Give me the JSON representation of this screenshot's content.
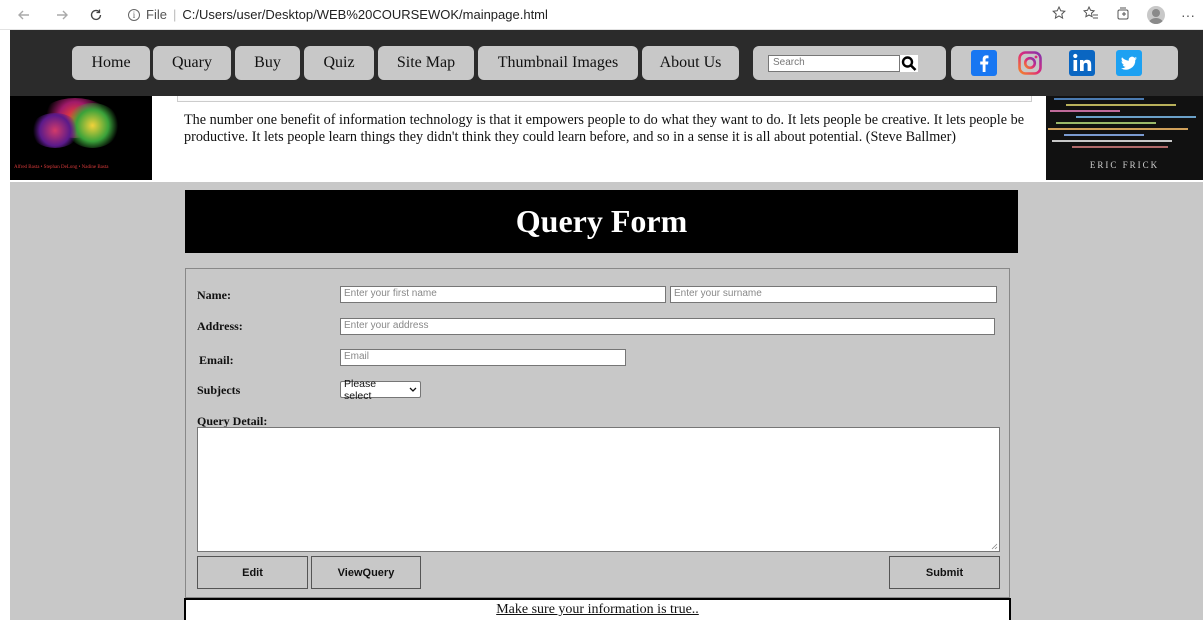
{
  "browser": {
    "back_icon": "back-arrow-icon",
    "forward_icon": "forward-arrow-icon",
    "refresh_icon": "refresh-icon",
    "info_label": "File",
    "url": "C:/Users/user/Desktop/WEB%20COURSEWOK/mainpage.html",
    "right_icons": [
      "read-aloud-icon",
      "favorites-icon",
      "collections-icon",
      "profile-avatar",
      "more-icon"
    ],
    "more_label": "···"
  },
  "nav": {
    "items": [
      "Home",
      "Quary",
      "Buy",
      "Quiz",
      "Site Map",
      "Thumbnail Images",
      "About Us"
    ],
    "search_placeholder": "Search",
    "social": [
      {
        "name": "facebook",
        "color": "#1877F2"
      },
      {
        "name": "instagram",
        "color": "#C13584"
      },
      {
        "name": "linkedin",
        "color": "#0A66C2"
      },
      {
        "name": "twitter",
        "color": "#1DA1F2"
      }
    ]
  },
  "header": {
    "quote": "The number one benefit of information technology is that it empowers people to do what they want to do. It lets people be creative. It lets people be productive. It lets people learn things they didn't think they could learn before, and so in a sense it is all about potential. (Steve Ballmer)",
    "left_book_authors": "Alfred Basta • Stephan DeLong • Nadine Basta",
    "right_book_author": "ERIC FRICK"
  },
  "form": {
    "title": "Query Form",
    "name_label": "Name:",
    "first_name_placeholder": "Enter your first name",
    "surname_placeholder": "Enter your surname",
    "address_label": "Address:",
    "address_placeholder": "Enter your address",
    "email_label": "Email:",
    "email_placeholder": "Email",
    "subjects_label": "Subjects",
    "subjects_selected": "Please select",
    "detail_label": "Query Detail:",
    "edit_label": "Edit",
    "view_label": "ViewQuery",
    "submit_label": "Submit",
    "notice": "Make sure your information is true.."
  },
  "colors": {
    "nav_bar": "#2b2b2b",
    "nav_button": "#c8c8c8",
    "page_grey": "#c8c8c8",
    "title_bg": "#000000"
  }
}
